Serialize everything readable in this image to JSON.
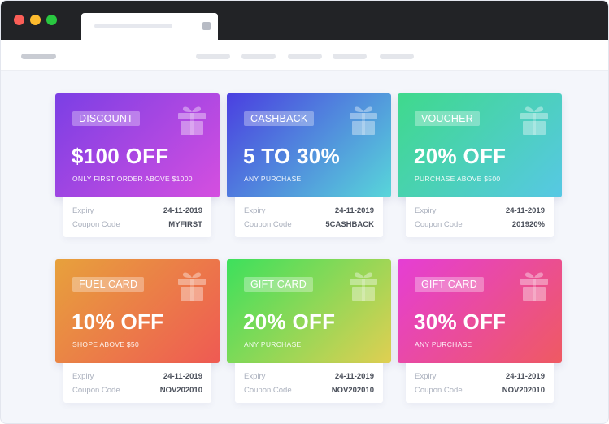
{
  "expiry_label": "Expiry",
  "code_label": "Coupon Code",
  "coupons": [
    {
      "badge": "DISCOUNT",
      "offer": "$100 OFF",
      "condition": "ONLY FIRST ORDER ABOVE $1000",
      "expiry": "24-11-2019",
      "code": "MYFIRST",
      "gradient_from": "#7b3fe4",
      "gradient_to": "#d54fe0"
    },
    {
      "badge": "CASHBACK",
      "offer": "5 TO 30%",
      "condition": "ANY PURCHASE",
      "expiry": "24-11-2019",
      "code": "5CASHBACK",
      "gradient_from": "#4a3fe0",
      "gradient_to": "#58d6da"
    },
    {
      "badge": "VOUCHER",
      "offer": "20% OFF",
      "condition": "PURCHASE ABOVE $500",
      "expiry": "24-11-2019",
      "code": "201920%",
      "gradient_from": "#3fd98c",
      "gradient_to": "#57c8e4"
    },
    {
      "badge": "FUEL CARD",
      "offer": "10% OFF",
      "condition": "SHOPE ABOVE $50",
      "expiry": "24-11-2019",
      "code": "NOV202010",
      "gradient_from": "#e7a13c",
      "gradient_to": "#ef5a53"
    },
    {
      "badge": "GIFT CARD",
      "offer": "20% OFF",
      "condition": "ANY PURCHASE",
      "expiry": "24-11-2019",
      "code": "NOV202010",
      "gradient_from": "#3de05c",
      "gradient_to": "#e0cf52"
    },
    {
      "badge": "GIFT CARD",
      "offer": "30% OFF",
      "condition": "ANY PURCHASE",
      "expiry": "24-11-2019",
      "code": "NOV202010",
      "gradient_from": "#e53ed5",
      "gradient_to": "#ef5a62"
    }
  ]
}
